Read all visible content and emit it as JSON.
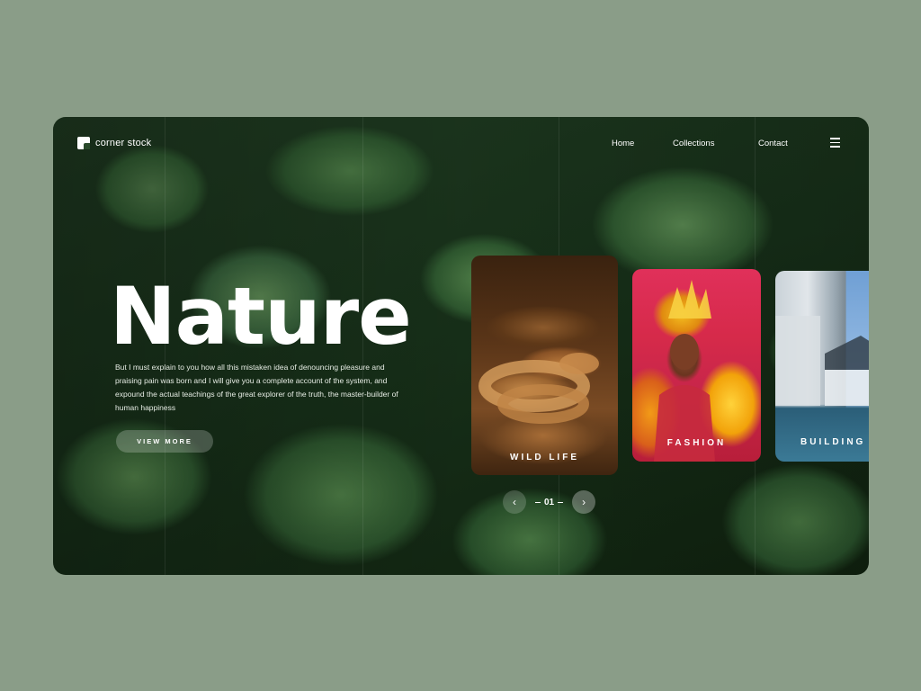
{
  "header": {
    "brand": "corner stock",
    "nav": [
      "Home",
      "Collections",
      "Contact"
    ]
  },
  "hero": {
    "title": "Nature",
    "description": "But I must explain to you how all this mistaken idea of denouncing pleasure and praising pain was born and I will give you a complete account of the system, and expound the actual teachings of the great explorer of the truth, the master-builder of human happiness",
    "cta": "VIEW MORE"
  },
  "cards": [
    {
      "label": "WILD LIFE"
    },
    {
      "label": "FASHION"
    },
    {
      "label": "BUILDING"
    }
  ],
  "pager": {
    "current": "01"
  },
  "icons": {
    "logo": "square-logo-icon",
    "menu": "hamburger-menu-icon",
    "prev": "chevron-left-icon",
    "next": "chevron-right-icon"
  },
  "colors": {
    "background": "#8a9d88",
    "accent": "#ffffff"
  }
}
